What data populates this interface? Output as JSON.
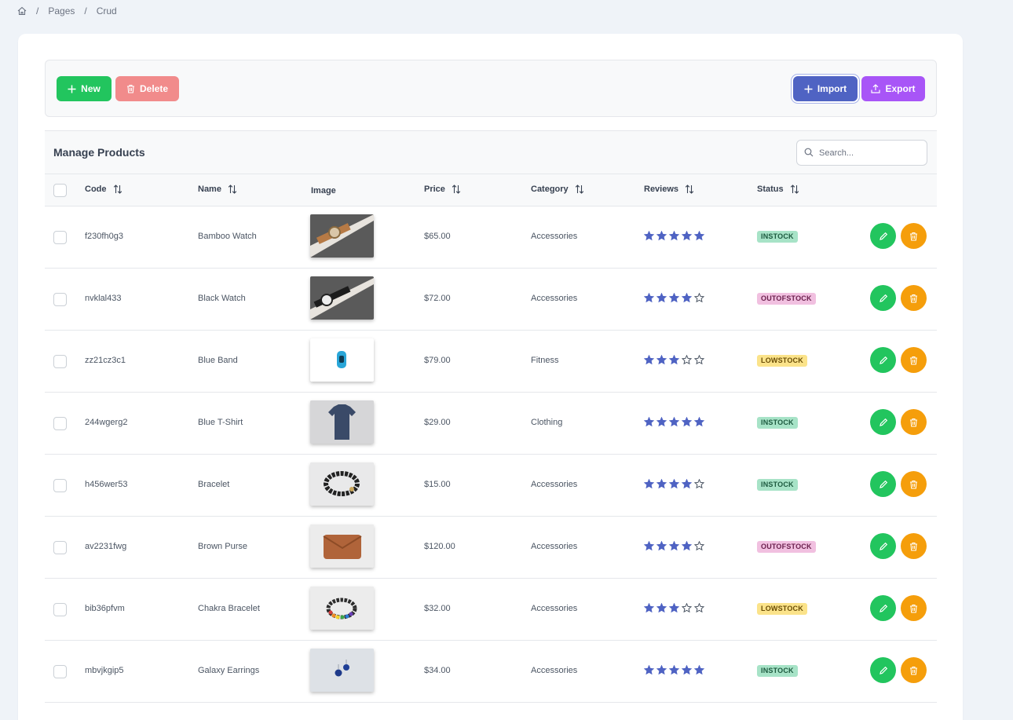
{
  "breadcrumb": {
    "items": [
      "Pages",
      "Crud"
    ],
    "separator": "/"
  },
  "toolbar": {
    "new_label": "New",
    "delete_label": "Delete",
    "import_label": "Import",
    "export_label": "Export"
  },
  "table": {
    "title": "Manage Products",
    "search_placeholder": "Search...",
    "columns": {
      "code": "Code",
      "name": "Name",
      "image": "Image",
      "price": "Price",
      "category": "Category",
      "reviews": "Reviews",
      "status": "Status"
    },
    "rows": [
      {
        "code": "f230fh0g3",
        "name": "Bamboo Watch",
        "price": "$65.00",
        "category": "Accessories",
        "rating": 5,
        "status": "INSTOCK",
        "image_icon": "bamboo-watch-image"
      },
      {
        "code": "nvklal433",
        "name": "Black Watch",
        "price": "$72.00",
        "category": "Accessories",
        "rating": 4,
        "status": "OUTOFSTOCK",
        "image_icon": "black-watch-image"
      },
      {
        "code": "zz21cz3c1",
        "name": "Blue Band",
        "price": "$79.00",
        "category": "Fitness",
        "rating": 3,
        "status": "LOWSTOCK",
        "image_icon": "blue-band-image"
      },
      {
        "code": "244wgerg2",
        "name": "Blue T-Shirt",
        "price": "$29.00",
        "category": "Clothing",
        "rating": 5,
        "status": "INSTOCK",
        "image_icon": "blue-tshirt-image"
      },
      {
        "code": "h456wer53",
        "name": "Bracelet",
        "price": "$15.00",
        "category": "Accessories",
        "rating": 4,
        "status": "INSTOCK",
        "image_icon": "bracelet-image"
      },
      {
        "code": "av2231fwg",
        "name": "Brown Purse",
        "price": "$120.00",
        "category": "Accessories",
        "rating": 4,
        "status": "OUTOFSTOCK",
        "image_icon": "brown-purse-image"
      },
      {
        "code": "bib36pfvm",
        "name": "Chakra Bracelet",
        "price": "$32.00",
        "category": "Accessories",
        "rating": 3,
        "status": "LOWSTOCK",
        "image_icon": "chakra-bracelet-image"
      },
      {
        "code": "mbvjkgip5",
        "name": "Galaxy Earrings",
        "price": "$34.00",
        "category": "Accessories",
        "rating": 5,
        "status": "INSTOCK",
        "image_icon": "galaxy-earrings-image"
      }
    ]
  },
  "colors": {
    "new": "#22c55e",
    "delete": "#f18b8b",
    "import": "#4f63c3",
    "export": "#a855f7",
    "star": "#4f63c3",
    "edit": "#22c55e",
    "trash": "#f59e0b"
  }
}
